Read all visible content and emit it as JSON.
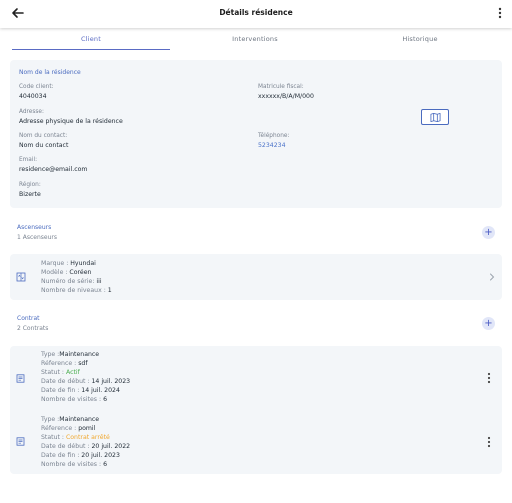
{
  "app": {
    "title": "Détails résidence"
  },
  "tabs": [
    {
      "label": "Client",
      "active": true
    },
    {
      "label": "Interventions",
      "active": false
    },
    {
      "label": "Historique",
      "active": false
    }
  ],
  "client": {
    "residence_name": "Nom de la résidence",
    "code_label": "Code client:",
    "code_value": "4040034",
    "matricule_label": "Matricule fiscal:",
    "matricule_value": "xxxxxx/B/A/M/000",
    "address_label": "Adresse:",
    "address_value": "Adresse physique de la résidence",
    "contact_label": "Nom du contact:",
    "contact_value": "Nom du contact",
    "phone_label": "Téléphone:",
    "phone_value": "5234234",
    "email_label": "Email:",
    "email_value": "residence@email.com",
    "region_label": "Région:",
    "region_value": "Bizerte"
  },
  "ascenseurs": {
    "title": "Ascenseurs",
    "count": "1 Ascenseurs",
    "items": [
      {
        "marque_label": "Marque :",
        "marque": "Hyundai",
        "modele_label": "Modèle :",
        "modele": "Coréen",
        "serie_label": "Numéro de série:",
        "serie": "iii",
        "niveaux_label": "Nombre de niveaux :",
        "niveaux": "1"
      }
    ]
  },
  "contrats": {
    "title": "Contrat",
    "count": "2 Contrats",
    "items": [
      {
        "type_label": "Type :",
        "type": "Maintenance",
        "ref_label": "Réference :",
        "ref": "sdf",
        "statut_label": "Statut :",
        "statut": "Actif",
        "debut_label": "Date de début :",
        "debut": "14 juil. 2023",
        "fin_label": "Date de fin :",
        "fin": "14 juil. 2024",
        "visites_label": "Nombre de visites :",
        "visites": "6"
      },
      {
        "type_label": "Type :",
        "type": "Maintenance",
        "ref_label": "Réference :",
        "ref": "pomil",
        "statut_label": "Statut :",
        "statut": "Contrat arrêté",
        "debut_label": "Date de début :",
        "debut": "20 juil. 2022",
        "fin_label": "Date de fin :",
        "fin": "20 juil. 2023",
        "visites_label": "Nombre de visites :",
        "visites": "6"
      }
    ]
  },
  "colors": {
    "accent": "#5a6bc4",
    "card_bg": "#f3f6f9",
    "active_status": "#4caf50",
    "stopped_status": "#f0a830"
  },
  "icons": {
    "back": "arrow-left-icon",
    "more": "more-vertical-icon",
    "map": "map-icon",
    "add": "plus-icon",
    "elevator": "elevator-icon",
    "chevron": "chevron-right-icon",
    "contract": "document-icon"
  },
  "add_symbol": "+"
}
